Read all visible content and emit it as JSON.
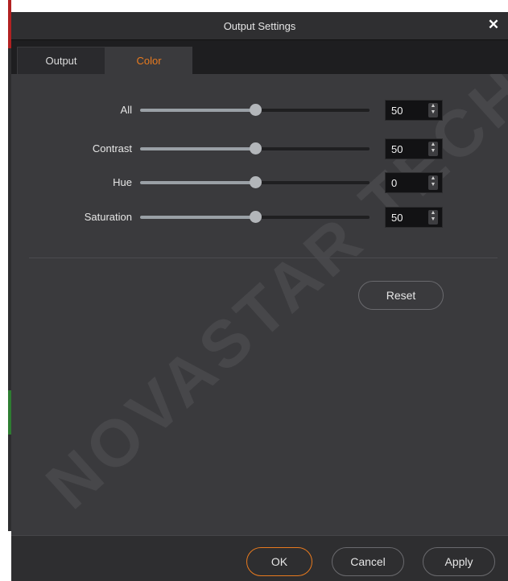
{
  "dialog": {
    "title": "Output Settings",
    "close_icon": "close-icon"
  },
  "tabs": [
    {
      "label": "Output",
      "active": false
    },
    {
      "label": "Color",
      "active": true
    }
  ],
  "sliders": [
    {
      "label": "All",
      "value": "50",
      "fraction": 0.5
    },
    {
      "label": "Contrast",
      "value": "50",
      "fraction": 0.5
    },
    {
      "label": "Hue",
      "value": "0",
      "fraction": 0.5
    },
    {
      "label": "Saturation",
      "value": "50",
      "fraction": 0.5
    }
  ],
  "buttons": {
    "reset": "Reset",
    "ok": "OK",
    "cancel": "Cancel",
    "apply": "Apply"
  },
  "watermark": "NOVASTAR TECH",
  "colors": {
    "accent": "#e87a1e",
    "background": "#3a3a3d",
    "titlebar": "#2f2f31"
  }
}
